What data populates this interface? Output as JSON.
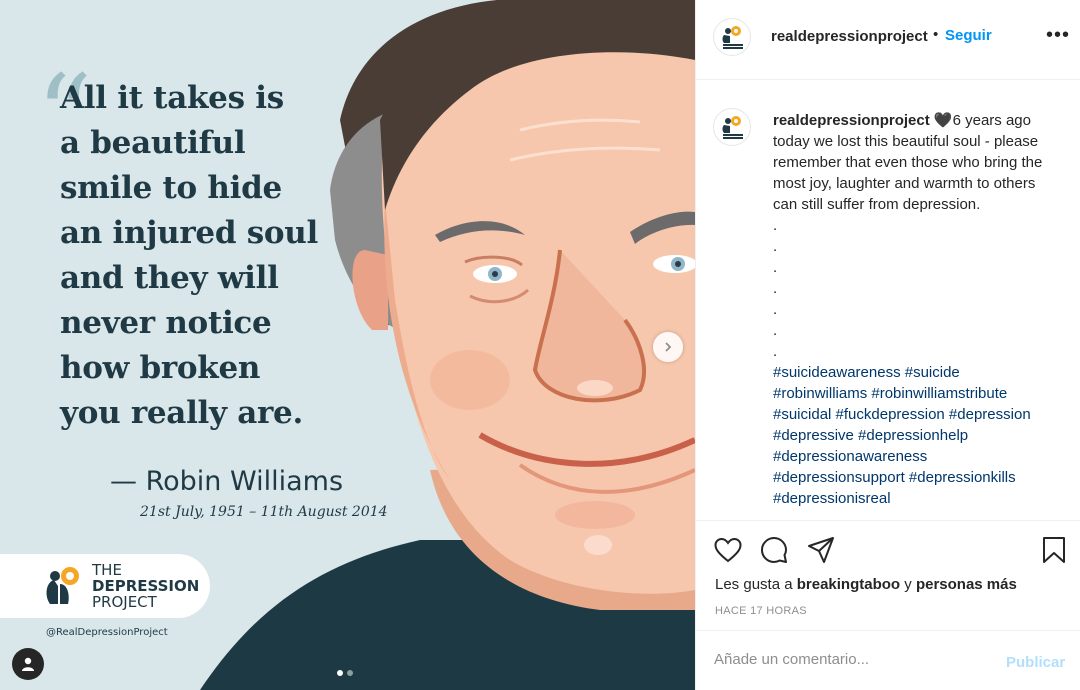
{
  "media": {
    "quote_mark": "“",
    "quote_lines": [
      "All it takes is",
      "a beautiful",
      "smile to hide",
      "an injured soul",
      "and they will",
      "never notice",
      "how broken",
      "you really are."
    ],
    "author": "— Robin Williams",
    "dates": "21st July, 1951 – 11th August 2014",
    "logo_line1": "THE",
    "logo_line2": "DEPRESSION",
    "logo_line3": "PROJECT",
    "handle": "@RealDepressionProject",
    "carousel_total": 2,
    "carousel_current": 1,
    "icons": {
      "next": "chevron-right-icon",
      "tagged_user": "user-icon"
    }
  },
  "header": {
    "username": "realdepressionproject",
    "separator": "•",
    "follow_label": "Seguir",
    "more_label": "•••"
  },
  "caption": {
    "username": "realdepressionproject",
    "heart": "🖤",
    "text": "6 years ago today we lost this beautiful soul - please remember that even those who bring the most joy, laughter and warmth to others can still suffer from depression.",
    "dots": [
      ".",
      ".",
      ".",
      ".",
      ".",
      ".",
      "."
    ],
    "hashtags": "#suicideawareness #suicide #robinwilliams #robinwilliamstribute #suicidal #fuckdepression #depression #depressive #depressionhelp #depressionawareness #depressionsupport #depressionkills #depressionisreal"
  },
  "actions": {
    "likes_prefix": "Les gusta a",
    "likes_user": "breakingtaboo",
    "likes_and": "y",
    "likes_others": "personas más",
    "time": "HACE 17 HORAS"
  },
  "comment": {
    "placeholder": "Añade un comentario...",
    "publish_label": "Publicar"
  },
  "colors": {
    "accent": "#0095f6",
    "publish_disabled": "#b2dffc",
    "hashtag": "#00376b",
    "quote_text": "#1f3a44",
    "media_bg": "#d9e6ea",
    "logo_orange": "#f5a623"
  }
}
